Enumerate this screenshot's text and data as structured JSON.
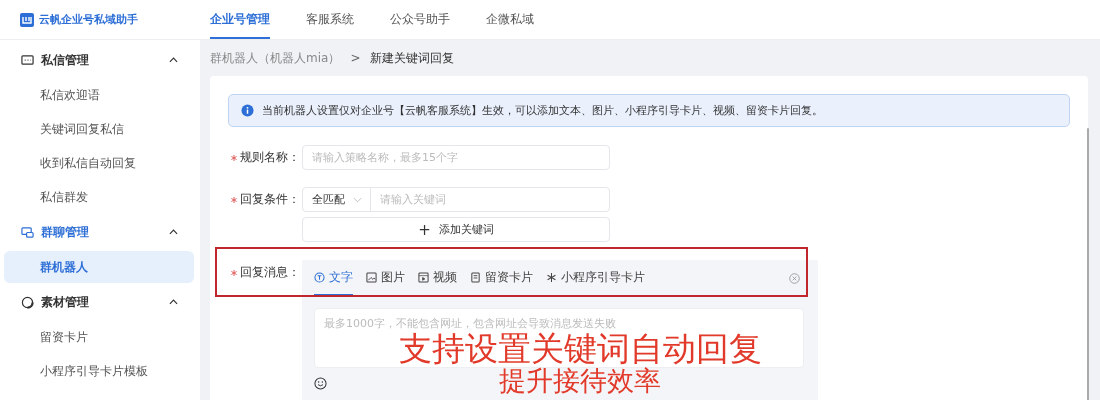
{
  "app": {
    "title": "云帆企业号私域助手"
  },
  "nav_tabs": [
    {
      "label": "企业号管理",
      "selected": true
    },
    {
      "label": "客服系统",
      "selected": false
    },
    {
      "label": "公众号助手",
      "selected": false
    },
    {
      "label": "企微私域",
      "selected": false
    }
  ],
  "sidebar": {
    "groups": [
      {
        "title": "私信管理",
        "kind": "message",
        "expanded": true,
        "selected": false,
        "items": [
          {
            "label": "私信欢迎语",
            "selected": false
          },
          {
            "label": "关键词回复私信",
            "selected": false
          },
          {
            "label": "收到私信自动回复",
            "selected": false
          },
          {
            "label": "私信群发",
            "selected": false
          }
        ]
      },
      {
        "title": "群聊管理",
        "kind": "group",
        "expanded": true,
        "selected": true,
        "items": [
          {
            "label": "群机器人",
            "selected": true
          }
        ]
      },
      {
        "title": "素材管理",
        "kind": "material",
        "expanded": true,
        "selected": false,
        "items": [
          {
            "label": "留资卡片",
            "selected": false
          },
          {
            "label": "小程序引导卡片模板",
            "selected": false
          }
        ]
      }
    ]
  },
  "breadcrumb": {
    "items": [
      "群机器人（机器人mia）",
      "新建关键词回复"
    ],
    "separator": ">"
  },
  "notice": {
    "text": "当前机器人设置仅对企业号【云帆客服系统】生效，可以添加文本、图片、小程序引导卡片、视频、留资卡片回复。"
  },
  "form": {
    "rule_name": {
      "label": "规则名称：",
      "required": true,
      "placeholder": "请输入策略名称，最多15个字"
    },
    "condition": {
      "label": "回复条件：",
      "required": true,
      "match": "全匹配",
      "placeholder": "请输入关键词"
    },
    "add_keyword": {
      "icon": "+",
      "label": "添加关键词"
    },
    "message": {
      "label": "回复消息：",
      "required": true,
      "placeholder": "最多1000字，不能包含网址，包含网址会导致消息发送失败",
      "tabs": [
        {
          "kind": "text",
          "label": "文字",
          "selected": true
        },
        {
          "kind": "image",
          "label": "图片",
          "selected": false
        },
        {
          "kind": "video",
          "label": "视频",
          "selected": false
        },
        {
          "kind": "card",
          "label": "留资卡片",
          "selected": false
        },
        {
          "kind": "miniprogram",
          "label": "小程序引导卡片",
          "selected": false
        }
      ]
    }
  },
  "overlay": {
    "lines": [
      "支持设置关键词自动回复",
      "提升接待效率"
    ]
  }
}
